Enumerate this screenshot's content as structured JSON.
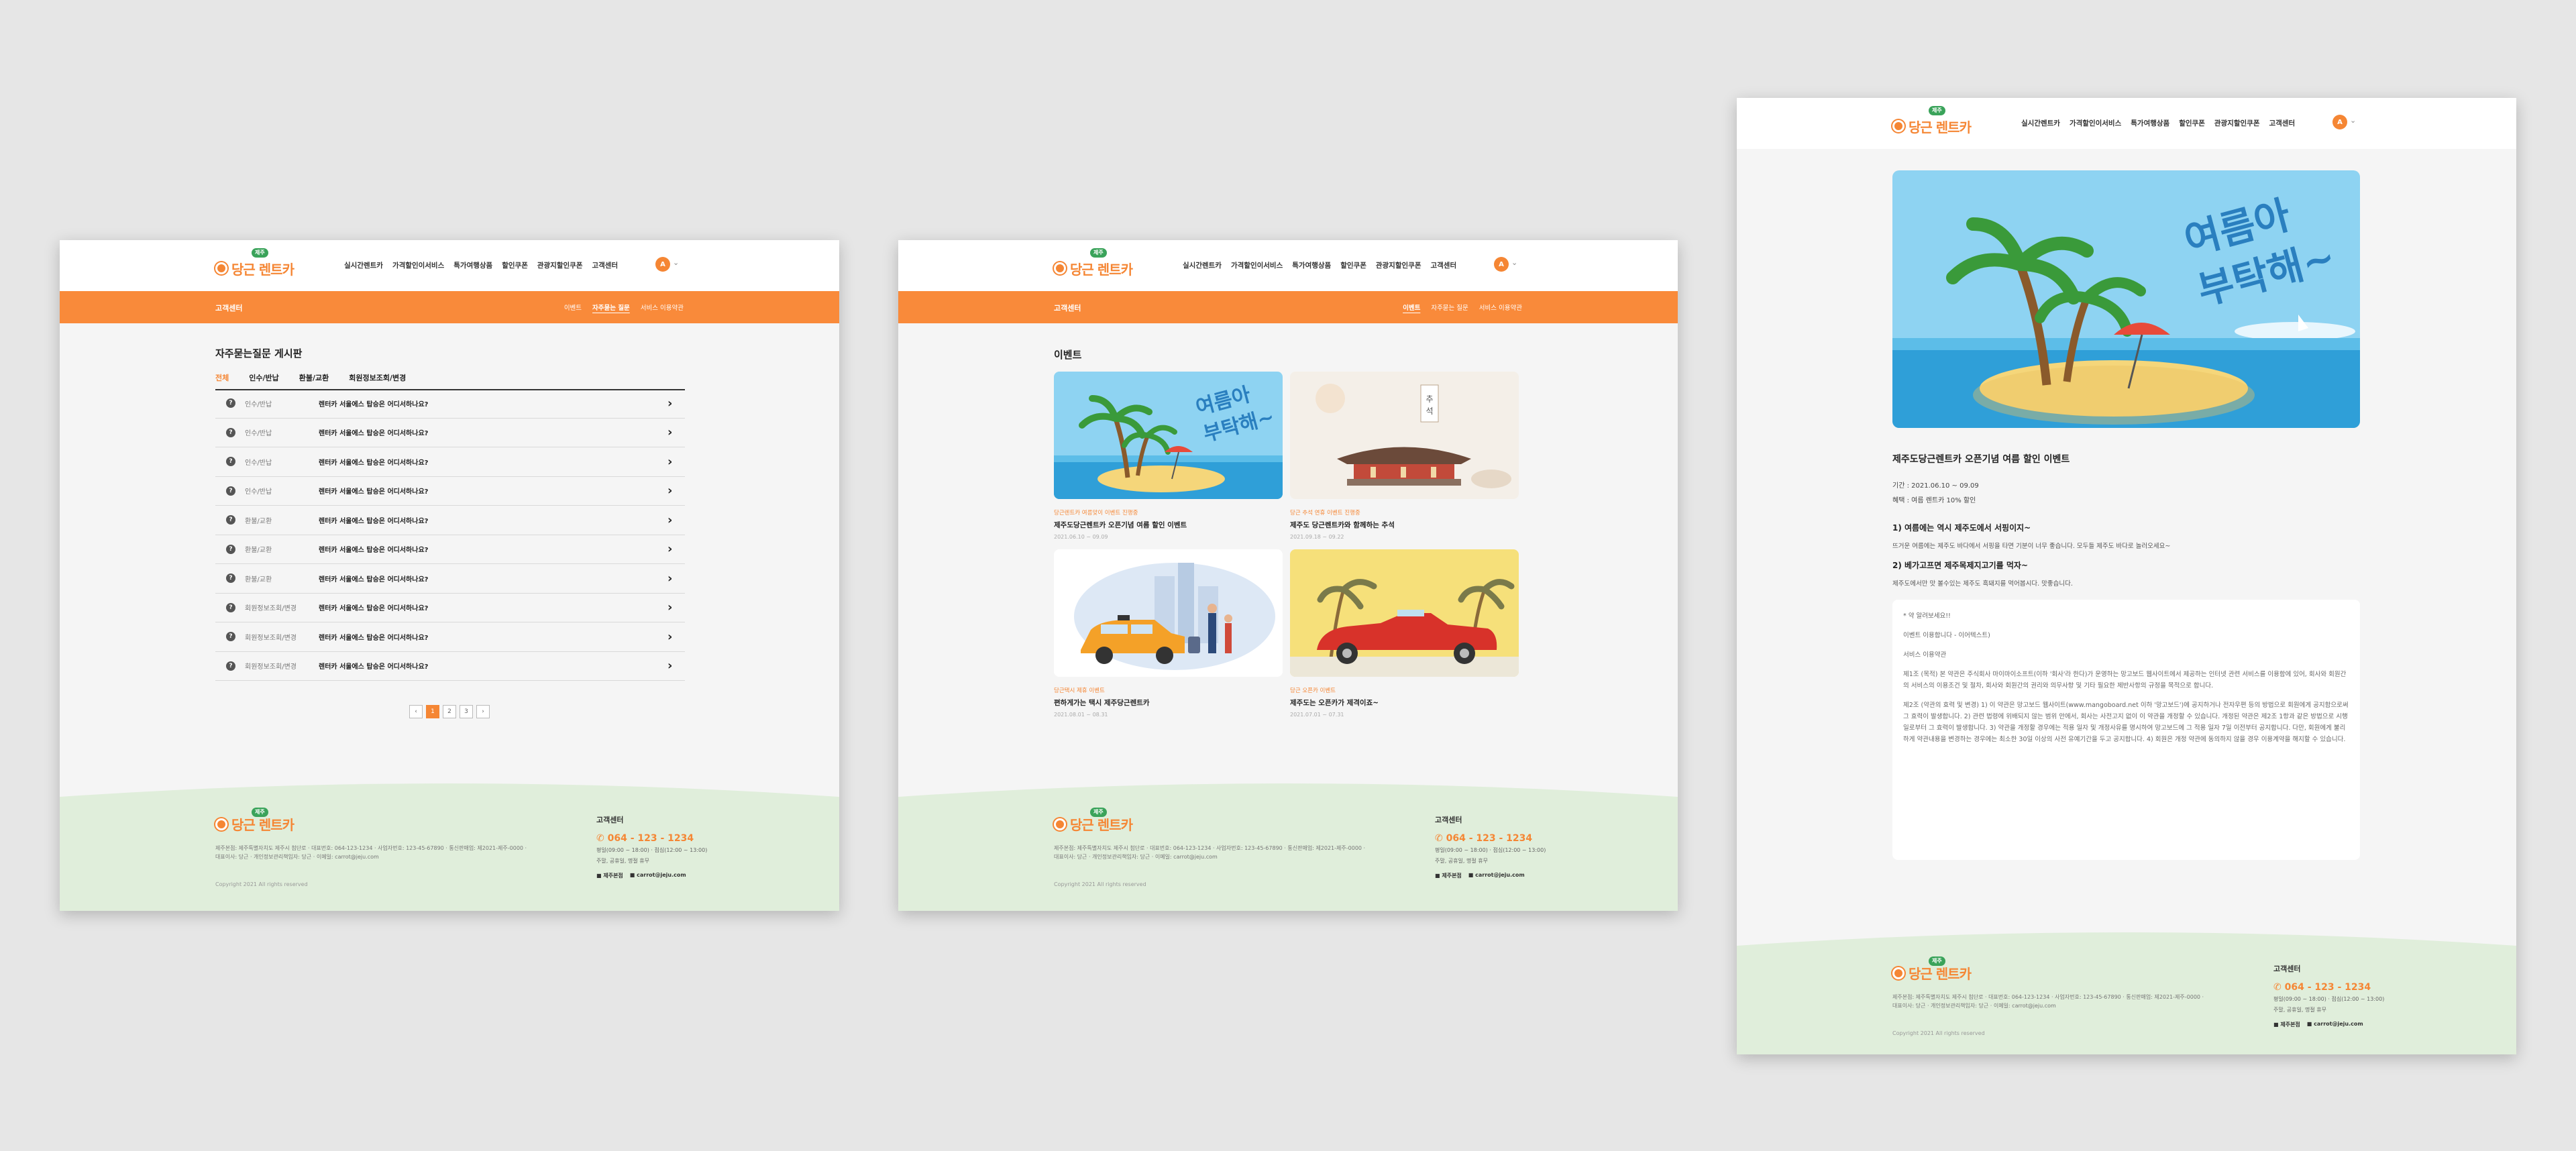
{
  "brand": {
    "logo_text": "당근 렌트카",
    "badge": "제주"
  },
  "nav": {
    "items": [
      "실시간렌트카",
      "가격할인이서비스",
      "특가여행상품",
      "할인쿠폰",
      "관광지할인쿠폰",
      "고객센터"
    ],
    "avatar": "A"
  },
  "colors": {
    "accent": "#f58634",
    "footer": "#e0eedb",
    "badge_green": "#3aa35a"
  },
  "subnav": {
    "title": "고객센터",
    "tabs": [
      "이벤트",
      "자주묻는 질문",
      "서비스 이용약관"
    ]
  },
  "faq_page": {
    "title": "자주묻는질문 게시판",
    "categories": [
      "전체",
      "인수/반납",
      "환불/교환",
      "회원정보조회/변경"
    ],
    "rows": [
      {
        "category": "인수/반납",
        "question": "렌터카 서울에스 탑승은 어디서하나요?"
      },
      {
        "category": "인수/반납",
        "question": "렌터카 서울에스 탑승은 어디서하나요?"
      },
      {
        "category": "인수/반납",
        "question": "렌터카 서울에스 탑승은 어디서하나요?"
      },
      {
        "category": "인수/반납",
        "question": "렌터카 서울에스 탑승은 어디서하나요?"
      },
      {
        "category": "환불/교환",
        "question": "렌터카 서울에스 탑승은 어디서하나요?"
      },
      {
        "category": "환불/교환",
        "question": "렌터카 서울에스 탑승은 어디서하나요?"
      },
      {
        "category": "환불/교환",
        "question": "렌터카 서울에스 탑승은 어디서하나요?"
      },
      {
        "category": "회원정보조회/변경",
        "question": "렌터카 서울에스 탑승은 어디서하나요?"
      },
      {
        "category": "회원정보조회/변경",
        "question": "렌터카 서울에스 탑승은 어디서하나요?"
      },
      {
        "category": "회원정보조회/변경",
        "question": "렌터카 서울에스 탑승은 어디서하나요?"
      }
    ],
    "pages": [
      "‹",
      "1",
      "2",
      "3",
      "›"
    ],
    "active_page": "1"
  },
  "event_page": {
    "title": "이벤트",
    "cards": [
      {
        "category": "당근렌트카 여름맞이 이벤트 진행중",
        "title": "제주도당근렌트카 오픈기념 여름 할인 이벤트",
        "date": "2021.06.10 ~ 09.09",
        "art": "summer"
      },
      {
        "category": "당근 추석 연휴 이벤트 진행중",
        "title": "제주도 당근렌트카와 함께하는 추석",
        "date": "2021.09.18 ~ 09.22",
        "art": "chuseok"
      },
      {
        "category": "당근택시 제휴 이벤트",
        "title": "편하게가는 택시 제주당근렌트카",
        "date": "2021.08.01 ~ 08.31",
        "art": "taxi"
      },
      {
        "category": "당근 오픈카 이벤트",
        "title": "제주도는 오픈카가 제격이죠~",
        "date": "2021.07.01 ~ 07.31",
        "art": "opencar"
      }
    ]
  },
  "banner_text": {
    "line1": "여름아",
    "line2": "부탁해~"
  },
  "detail_page": {
    "title": "제주도당근렌트카 오픈기념 여름 할인 이벤트",
    "period": "기간 : 2021.06.10 ~ 09.09",
    "benefit": "혜택 : 여름 렌트카 10% 할인",
    "h1": "1) 여름에는 역시 제주도에서 서핑이지~",
    "p1": "뜨거운 여름에는 제주도 바다에서 서핑을 타면 기분이 너무 좋습니다. 모두들 제주도 바다로 놀러오세요~",
    "h2": "2) 베가고프면 제주목제지고기를 먹자~",
    "p2": "제주도에서만 맛 볼수있는 제주도 흑돼지를 먹어봅시다. 맛좋습니다.",
    "terms": [
      "* 약 알려보세요!!",
      "이벤트 이용합니다 - 이어텍스트)",
      "서비스 이용약관",
      "제1조 (목적) 본 약관은 주식회사 마이마이소프트(이하 '회사'라 한다)가 운영하는 망고보드 웹사이트에서 제공하는 인터넷 관련 서비스를 이용함에 있어, 회사와 회원간의 서비스의 이용조건 및 절차, 회사와 회원간의 권리와 의무사항 및 기타 필요한 제반사항의 규정을 목적으로 합니다.",
      "제2조 (약관의 효력 및 변경) 1) 이 약관은 망고보드 웹사이트(www.mangoboard.net 이하 '망고보드')에 공지하거나 전자우편 등의 방법으로 회원에게 공지함으로써 그 효력이 발생합니다. 2) 관련 법령에 위배되지 않는 범위 안에서, 회사는 사전고지 없이 이 약관을 개정할 수 있습니다. 개정된 약관은 제2조 1항과 같은 방법으로 시행일로부터 그 효력이 발생합니다. 3) 약관을 개정할 경우에는 적용 일자 및 개정사유를 명시하여 망고보드에 그 적용 일자 7일 이전부터 공지합니다. 다만, 회원에게 불리하게 약관내용을 변경하는 경우에는 최소한 30일 이상의 사전 유예기간을 두고 공지합니다. 4) 회원은 개정 약관에 동의하지 않을 경우 이용계약을 해지할 수 있습니다."
    ]
  },
  "footer": {
    "info": "제주본점: 제주특별자치도 제주시 첨단로 · 대표번호: 064-123-1234 · 사업자번호: 123-45-67890 · 통신판매업: 제2021-제주-0000 · 대표이사: 당근 · 개인정보관리책임자: 당근 · 이메일: carrot@jeju.com",
    "copyright": "Copyright 2021 All rights reserved",
    "cs_label": "고객센터",
    "tel": "064 - 123 - 1234",
    "hours": "평일(09:00 ~ 18:00) · 점심(12:00 ~ 13:00)",
    "hours2": "주말, 공휴일, 명절 휴무",
    "link1": "제주본점",
    "link2": "carrot@jeju.com"
  }
}
